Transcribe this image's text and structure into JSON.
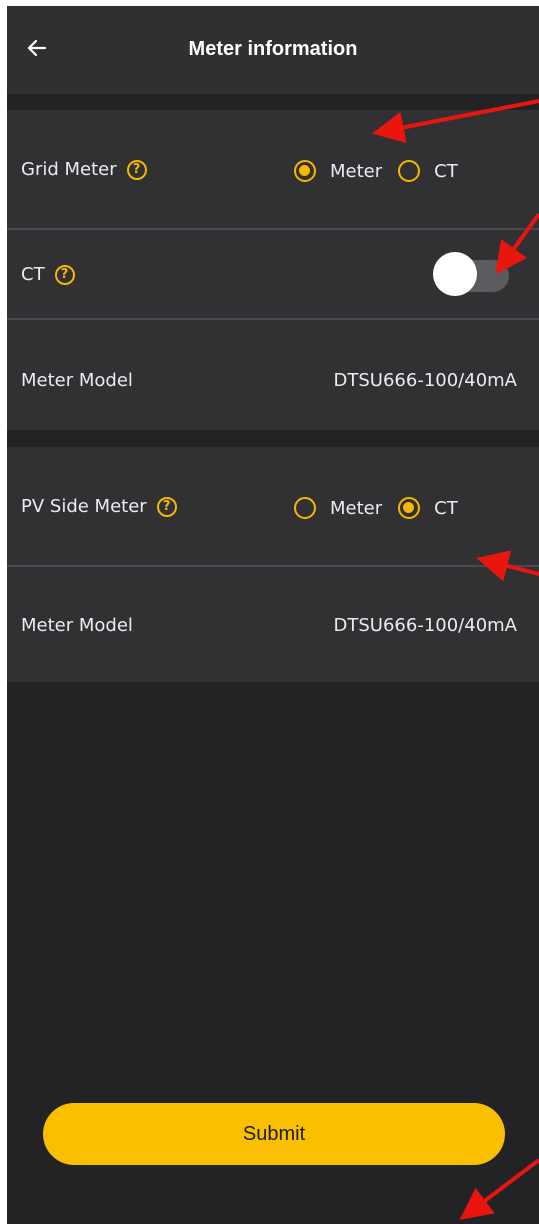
{
  "header": {
    "title": "Meter information",
    "back_icon": "arrow-left-icon"
  },
  "grid_card": {
    "grid_meter": {
      "label": "Grid Meter",
      "help_icon": "?",
      "options": [
        {
          "label": "Meter",
          "selected": true
        },
        {
          "label": "CT",
          "selected": false
        }
      ]
    },
    "ct": {
      "label": "CT",
      "help_icon": "?",
      "toggle_on": false
    },
    "meter_model": {
      "label": "Meter Model",
      "value": "DTSU666-100/40mA"
    }
  },
  "pv_card": {
    "pv_side_meter": {
      "label": "PV Side Meter",
      "help_icon": "?",
      "options": [
        {
          "label": "Meter",
          "selected": false
        },
        {
          "label": "CT",
          "selected": true
        }
      ]
    },
    "meter_model": {
      "label": "Meter Model",
      "value": "DTSU666-100/40mA"
    }
  },
  "footer": {
    "submit_label": "Submit"
  },
  "colors": {
    "accent": "#f5b800",
    "button": "#fabf00",
    "background": "#232224",
    "card": "#313033",
    "annotation_arrow": "#e8160f"
  }
}
